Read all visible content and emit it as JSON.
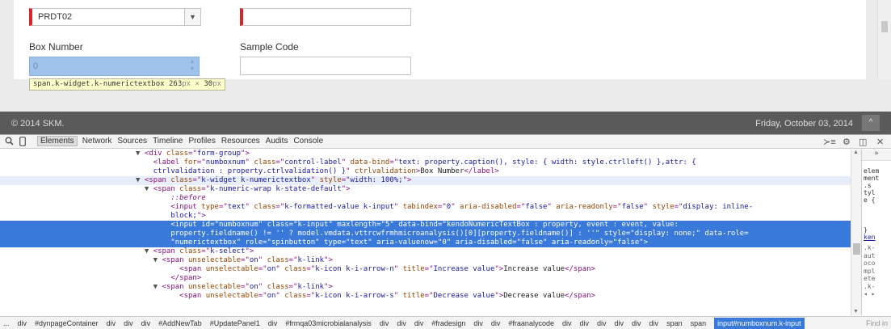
{
  "form": {
    "select_value": "PRDT02",
    "select_arrow": "▼",
    "box_number_label": "Box Number",
    "sample_code_label": "Sample Code",
    "box_number_value": "0",
    "spin_up": "▲",
    "spin_down": "▼",
    "tooltip_selector": "span.k-widget.k-numerictextbox",
    "tooltip_w": "263",
    "tooltip_h": "30",
    "tooltip_unit": "px",
    "tooltip_times": "×"
  },
  "footer": {
    "copyright": "© 2014 SKM.",
    "date": "Friday, October 03, 2014",
    "up_icon": "^"
  },
  "devtools": {
    "tabs": [
      "Elements",
      "Network",
      "Sources",
      "Timeline",
      "Profiles",
      "Resources",
      "Audits",
      "Console"
    ],
    "active_tab": "Elements",
    "icons": [
      "search-icon",
      "device-mode-icon",
      "drawer-toggle-icon",
      "gear-icon",
      "dock-icon",
      "close-icon"
    ],
    "lines": [
      {
        "indent": 33,
        "tri": "▼",
        "html": "<span class=\"tag\">&lt;div </span><span class=\"an\">class</span><span class=\"tag\">=\"</span><span class=\"av\">form-group</span><span class=\"tag\">\"&gt;</span>"
      },
      {
        "indent": 35,
        "tri": "",
        "html": "<span class=\"tag\">&lt;label </span><span class=\"an\">for</span><span class=\"tag\">=\"</span><span class=\"av\">numboxnum</span><span class=\"tag\">\" </span><span class=\"an\">class</span><span class=\"tag\">=\"</span><span class=\"av\">control-label</span><span class=\"tag\">\" </span><span class=\"an\">data-bind</span><span class=\"tag\">=\"</span><span class=\"av\">text: property.caption(), style: { width: style.ctrlleft() },attr: {</span>"
      },
      {
        "indent": 35,
        "tri": "",
        "html": "<span class=\"av\">ctrlvalidation : property.ctrlvalidation() }</span><span class=\"tag\">\" </span><span class=\"an\">ctrlvalidation</span><span class=\"tag\">&gt;</span><span class=\"tx\">Box Number</span><span class=\"tag\">&lt;/label&gt;</span>"
      },
      {
        "indent": 33,
        "tri": "▼",
        "hover": true,
        "html": "<span class=\"tag\">&lt;span </span><span class=\"an\">class</span><span class=\"tag\">=\"</span><span class=\"av\">k-widget k-numerictextbox</span><span class=\"tag\">\" </span><span class=\"an\">style</span><span class=\"tag\">=\"</span><span class=\"av\">width: 100%;</span><span class=\"tag\">\"&gt;</span>"
      },
      {
        "indent": 35,
        "tri": "▼",
        "html": "<span class=\"tag\">&lt;span </span><span class=\"an\">class</span><span class=\"tag\">=\"</span><span class=\"av\">k-numeric-wrap k-state-default</span><span class=\"tag\">\"&gt;</span>"
      },
      {
        "indent": 39,
        "tri": "",
        "html": "<span class=\"ps\">::before</span>"
      },
      {
        "indent": 39,
        "tri": "",
        "html": "<span class=\"tag\">&lt;input </span><span class=\"an\">type</span><span class=\"tag\">=\"</span><span class=\"av\">text</span><span class=\"tag\">\" </span><span class=\"an\">class</span><span class=\"tag\">=\"</span><span class=\"av\">k-formatted-value k-input</span><span class=\"tag\">\" </span><span class=\"an\">tabindex</span><span class=\"tag\">=\"</span><span class=\"av\">0</span><span class=\"tag\">\" </span><span class=\"an\">aria-disabled</span><span class=\"tag\">=\"</span><span class=\"av\">false</span><span class=\"tag\">\" </span><span class=\"an\">aria-readonly</span><span class=\"tag\">=\"</span><span class=\"av\">false</span><span class=\"tag\">\" </span><span class=\"an\">style</span><span class=\"tag\">=\"</span><span class=\"av\">display: inline-</span>"
      },
      {
        "indent": 39,
        "tri": "",
        "html": "<span class=\"av\">block;</span><span class=\"tag\">\"&gt;</span>"
      },
      {
        "indent": 39,
        "tri": "",
        "sel": true,
        "html": "<span class=\"tag\">&lt;input </span><span class=\"an\">id</span><span class=\"tag\">=\"</span><span class=\"av\">numboxnum</span><span class=\"tag\">\" </span><span class=\"an\">class</span><span class=\"tag\">=\"</span><span class=\"av\">k-input</span><span class=\"tag\">\" </span><span class=\"an\">maxlength</span><span class=\"tag\">=\"</span><span class=\"av\">5</span><span class=\"tag\">\" </span><span class=\"an\">data-bind</span><span class=\"tag\">=\"</span><span class=\"av\">kendoNumericTextBox : property, event : event, value:</span>"
      },
      {
        "indent": 39,
        "tri": "",
        "sel": true,
        "html": "<span class=\"av\">property.fieldname() != '' ? model.vmdata.vttrcwfrmhmicroanalysis()[0][property.fieldname()] : ''</span><span class=\"tag\">\" </span><span class=\"an\">style</span><span class=\"tag\">=\"</span><span class=\"av\">display: none;</span><span class=\"tag\">\" </span><span class=\"an\">data-role</span><span class=\"tag\">=</span>"
      },
      {
        "indent": 39,
        "tri": "",
        "sel": true,
        "html": "<span class=\"tag\">\"</span><span class=\"av\">numerictextbox</span><span class=\"tag\">\" </span><span class=\"an\">role</span><span class=\"tag\">=\"</span><span class=\"av\">spinbutton</span><span class=\"tag\">\" </span><span class=\"an\">type</span><span class=\"tag\">=\"</span><span class=\"av\">text</span><span class=\"tag\">\" </span><span class=\"an\">aria-valuenow</span><span class=\"tag\">=\"</span><span class=\"av\">0</span><span class=\"tag\">\" </span><span class=\"an\">aria-disabled</span><span class=\"tag\">=\"</span><span class=\"av\">false</span><span class=\"tag\">\" </span><span class=\"an\">aria-readonly</span><span class=\"tag\">=\"</span><span class=\"av\">false</span><span class=\"tag\">\"&gt;</span>"
      },
      {
        "indent": 35,
        "tri": "▼",
        "html": "<span class=\"tag\">&lt;span </span><span class=\"an\">class</span><span class=\"tag\">=\"</span><span class=\"av\">k-select</span><span class=\"tag\">\"&gt;</span>"
      },
      {
        "indent": 37,
        "tri": "▼",
        "html": "<span class=\"tag\">&lt;span </span><span class=\"an\">unselectable</span><span class=\"tag\">=\"</span><span class=\"av\">on</span><span class=\"tag\">\" </span><span class=\"an\">class</span><span class=\"tag\">=\"</span><span class=\"av\">k-link</span><span class=\"tag\">\"&gt;</span>"
      },
      {
        "indent": 41,
        "tri": "",
        "html": "<span class=\"tag\">&lt;span </span><span class=\"an\">unselectable</span><span class=\"tag\">=\"</span><span class=\"av\">on</span><span class=\"tag\">\" </span><span class=\"an\">class</span><span class=\"tag\">=\"</span><span class=\"av\">k-icon k-i-arrow-n</span><span class=\"tag\">\" </span><span class=\"an\">title</span><span class=\"tag\">=\"</span><span class=\"av\">Increase value</span><span class=\"tag\">\"&gt;</span><span class=\"tx\">Increase value</span><span class=\"tag\">&lt;/span&gt;</span>"
      },
      {
        "indent": 39,
        "tri": "",
        "html": "<span class=\"tag\">&lt;/span&gt;</span>"
      },
      {
        "indent": 37,
        "tri": "▼",
        "html": "<span class=\"tag\">&lt;span </span><span class=\"an\">unselectable</span><span class=\"tag\">=\"</span><span class=\"av\">on</span><span class=\"tag\">\" </span><span class=\"an\">class</span><span class=\"tag\">=\"</span><span class=\"av\">k-link</span><span class=\"tag\">\"&gt;</span>"
      },
      {
        "indent": 41,
        "tri": "",
        "html": "<span class=\"tag\">&lt;span </span><span class=\"an\">unselectable</span><span class=\"tag\">=\"</span><span class=\"av\">on</span><span class=\"tag\">\" </span><span class=\"an\">class</span><span class=\"tag\">=\"</span><span class=\"av\">k-icon k-i-arrow-s</span><span class=\"tag\">\" </span><span class=\"an\">title</span><span class=\"tag\">=\"</span><span class=\"av\">Decrease value</span><span class=\"tag\">\"&gt;</span><span class=\"tx\">Decrease value</span><span class=\"tag\">&lt;/span&gt;</span>"
      }
    ],
    "side_top": "»",
    "side_block1": [
      "elem",
      "ment",
      ".s",
      "tyl",
      "e {"
    ],
    "side_close": "}",
    "side_link": "ken",
    "side_block3": [
      ".k-",
      "aut",
      "oco",
      "mpl",
      "ete",
      ".k-"
    ],
    "side_arrows": "◂ ▸",
    "breadcrumbs": [
      "...",
      "div",
      "#dynpageContainer",
      "div",
      "div",
      "div",
      "#AddNewTab",
      "#UpdatePanel1",
      "div",
      "#frmqa03microbialanalysis",
      "div",
      "div",
      "div",
      "#fradesign",
      "div",
      "div",
      "#fraanalycode",
      "div",
      "div",
      "div",
      "div",
      "div",
      "div",
      "span",
      "span"
    ],
    "active_crumb": "input#numboxnum.k-input",
    "find_label": "Find in"
  }
}
